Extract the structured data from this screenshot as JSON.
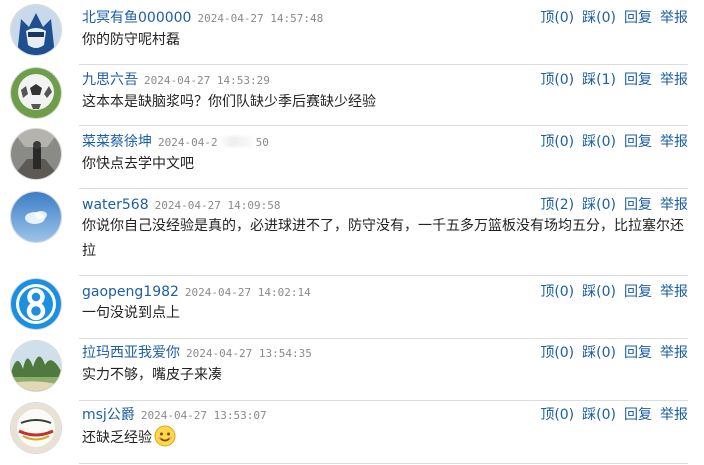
{
  "comments": [
    {
      "username": "北冥有鱼000000",
      "time": "2024-04-27 14:57:48",
      "text": "你的防守呢村磊",
      "avatar_icon": "blue-masked-hero-avatar",
      "up_label": "顶",
      "up_count": "(0)",
      "down_label": "踩",
      "down_count": "(0)",
      "reply_label": "回复",
      "report_label": "举报"
    },
    {
      "username": "九思六吾",
      "time": "2024-04-27 14:53:29",
      "text": "这本本是缺脑浆吗？你们队缺少季后赛缺少经验",
      "avatar_icon": "soccer-ball-avatar",
      "up_label": "顶",
      "up_count": "(0)",
      "down_label": "踩",
      "down_count": "(1)",
      "reply_label": "回复",
      "report_label": "举报"
    },
    {
      "username": "菜菜蔡徐坤",
      "time_visible": "2024-04-2",
      "time_tail": "50",
      "text": "你快点去学中文吧",
      "avatar_icon": "person-in-corridor-avatar",
      "up_label": "顶",
      "up_count": "(0)",
      "down_label": "踩",
      "down_count": "(0)",
      "reply_label": "回复",
      "report_label": "举报"
    },
    {
      "username": "water568",
      "time": "2024-04-27 14:09:58",
      "text": "你说你自己没经验是真的，必进球进不了，防守没有，一千五多万篮板没有场均五分，比拉塞尔还拉",
      "avatar_icon": "blue-sky-cloud-avatar",
      "up_label": "顶",
      "up_count": "(2)",
      "down_label": "踩",
      "down_count": "(0)",
      "reply_label": "回复",
      "report_label": "举报"
    },
    {
      "username": "gaopeng1982",
      "time": "2024-04-27 14:02:14",
      "text": "一句没说到点上",
      "avatar_icon": "blue-number-8-avatar",
      "up_label": "顶",
      "up_count": "(0)",
      "down_label": "踩",
      "down_count": "(0)",
      "reply_label": "回复",
      "report_label": "举报"
    },
    {
      "username": "拉玛西亚我爱你",
      "time": "2024-04-27 13:54:35",
      "text": "实力不够，嘴皮子来凑",
      "avatar_icon": "karst-mountain-landscape-avatar",
      "up_label": "顶",
      "up_count": "(0)",
      "down_label": "踩",
      "down_count": "(0)",
      "reply_label": "回复",
      "report_label": "举报"
    },
    {
      "username": "msj公爵",
      "time": "2024-04-27 13:53:07",
      "text": "还缺乏经验",
      "avatar_icon": "white-ball-avatar",
      "emoji_icon": "smiley-emoji-icon",
      "up_label": "顶",
      "up_count": "(0)",
      "down_label": "踩",
      "down_count": "(0)",
      "reply_label": "回复",
      "report_label": "举报"
    }
  ],
  "colors": {
    "link": "#1c5ea8",
    "text": "#222222",
    "time": "#8a8a8a",
    "separator": "#dcdcdc"
  }
}
